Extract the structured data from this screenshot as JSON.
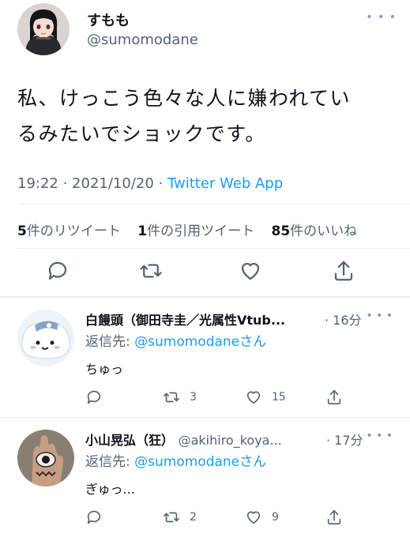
{
  "tweet": {
    "author_name": "すもも",
    "author_handle": "@sumomodane",
    "more_icon": "more-dots-icon",
    "text_line1": "私、けっこう色々な人に嫌われてい",
    "text_line2": "るみたいでショックです。",
    "time": "19:22",
    "sep1": " · ",
    "date": "2021/10/20",
    "sep2": " · ",
    "source": "Twitter Web App",
    "retweets_count": "5",
    "retweets_label": "件のリツイート",
    "quotes_count": "1",
    "quotes_label": "件の引用ツイート",
    "likes_count": "85",
    "likes_label": "件のいいね",
    "actions": [
      "reply-icon",
      "retweet-icon",
      "like-icon",
      "share-icon"
    ]
  },
  "replies": [
    {
      "name": "白饅頭（御田寺圭／光属性Vtub...",
      "time": "· 16分",
      "replyto_prefix": "返信先: ",
      "replyto_handle": "@sumomodane",
      "replyto_suffix": "さん",
      "text": "ちゅっ",
      "reply_count": "",
      "retweet_count": "3",
      "like_count": "15"
    },
    {
      "name": "小山晃弘（狂）",
      "handle": "@akihiro_koya...",
      "time": "· 17分",
      "replyto_prefix": "返信先: ",
      "replyto_handle": "@sumomodane",
      "replyto_suffix": "さん",
      "text": "ぎゅっ...",
      "reply_count": "",
      "retweet_count": "2",
      "like_count": "9"
    }
  ],
  "colors": {
    "link": "#1d9bf0",
    "muted": "#536471",
    "text": "#0f1419",
    "divider": "#e6ecf0"
  }
}
